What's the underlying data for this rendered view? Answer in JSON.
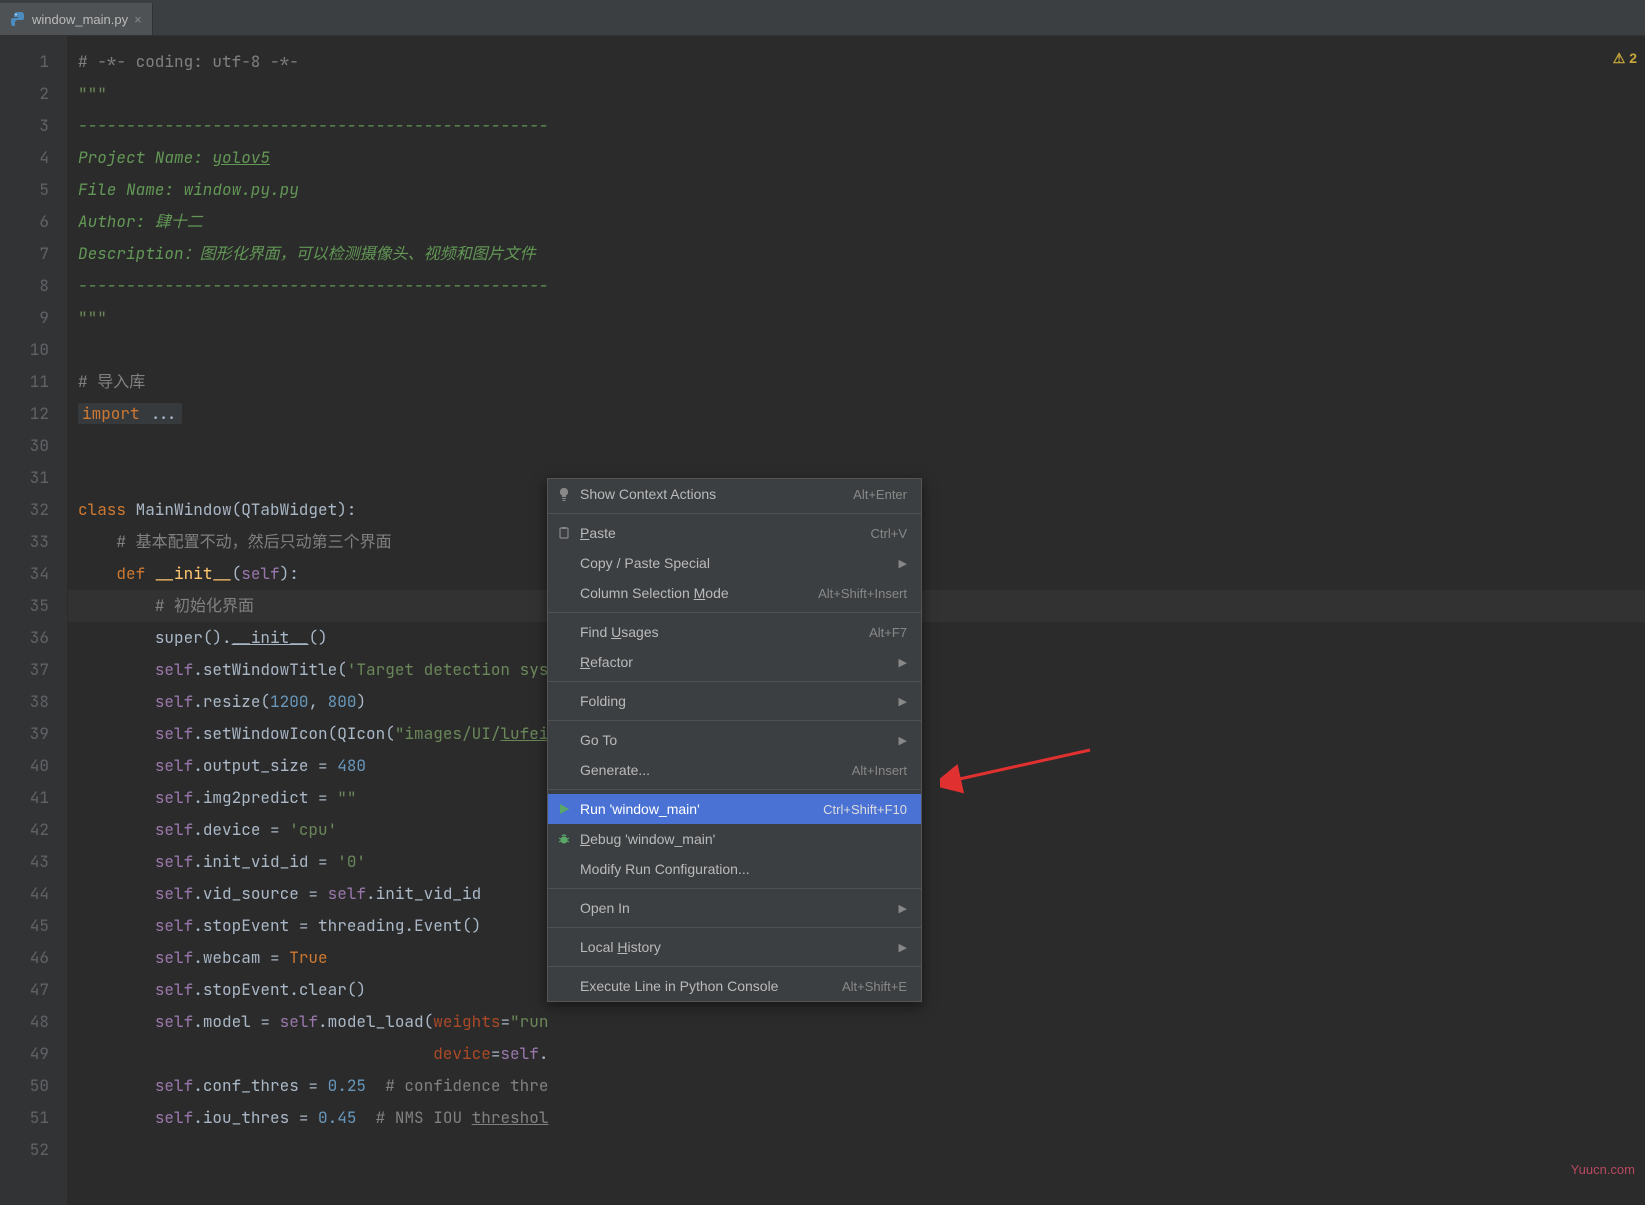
{
  "tab": {
    "filename": "window_main.py"
  },
  "warning_count": "2",
  "watermark": "Yuucn.com",
  "lines": [
    {
      "n": "1",
      "html": "<span class='c-gray'># -*- coding: utf-8 -*-</span>"
    },
    {
      "n": "2",
      "html": "<span class='c-green-str'>\"\"\"</span>"
    },
    {
      "n": "3",
      "html": "<span class='c-green'>-------------------------------------------------</span>"
    },
    {
      "n": "4",
      "html": "<span class='c-green'>Project Name: </span><span class='c-link'>yolov5</span>"
    },
    {
      "n": "5",
      "html": "<span class='c-green'>File Name: window.py.py</span>"
    },
    {
      "n": "6",
      "html": "<span class='c-green'>Author: 肆十二</span>"
    },
    {
      "n": "7",
      "html": "<span class='c-green'>Description：图形化界面，可以检测摄像头、视频和图片文件</span>"
    },
    {
      "n": "8",
      "html": "<span class='c-green'>-------------------------------------------------</span>"
    },
    {
      "n": "9",
      "html": "<span class='c-green-str'>\"\"\"</span>"
    },
    {
      "n": "10",
      "html": ""
    },
    {
      "n": "11",
      "html": "<span class='c-gray'># 导入库</span>"
    },
    {
      "n": "12",
      "html": "<span class='folded'><span class='c-orange'>import </span><span class='c-light'>...</span></span>"
    },
    {
      "n": "30",
      "html": ""
    },
    {
      "n": "31",
      "html": ""
    },
    {
      "n": "32",
      "html": "<span class='c-orange'>class </span><span class='c-light'>MainWindow(QTabWidget):</span>"
    },
    {
      "n": "33",
      "html": "    <span class='c-gray'># 基本配置不动，然后只动第三个界面</span>"
    },
    {
      "n": "34",
      "html": "    <span class='c-orange'>def </span><span class='c-yellow'>__init__</span><span class='c-light'>(</span><span class='c-purple'>self</span><span class='c-light'>):</span>"
    },
    {
      "n": "35",
      "html": "        <span class='c-gray'># 初始化界面</span>",
      "hl": true
    },
    {
      "n": "36",
      "html": "        <span class='c-light'>super().</span><span class='c-light c-under'>__init__</span><span class='c-light'>()</span>"
    },
    {
      "n": "37",
      "html": "        <span class='c-purple'>self</span><span class='c-light'>.setWindowTitle(</span><span class='c-green-str'>'Target detection sys</span>"
    },
    {
      "n": "38",
      "html": "        <span class='c-purple'>self</span><span class='c-light'>.resize(</span><span class='c-blue'>1200</span><span class='c-light'>, </span><span class='c-blue'>800</span><span class='c-light'>)</span>"
    },
    {
      "n": "39",
      "html": "        <span class='c-purple'>self</span><span class='c-light'>.setWindowIcon(QIcon(</span><span class='c-green-str'>\"images/UI/</span><span class='c-green-str c-under'>lufei</span>"
    },
    {
      "n": "40",
      "html": "        <span class='c-purple'>self</span><span class='c-light'>.output_size = </span><span class='c-blue'>480</span>"
    },
    {
      "n": "41",
      "html": "        <span class='c-purple'>self</span><span class='c-light'>.img2predict = </span><span class='c-green-str'>\"\"</span>"
    },
    {
      "n": "42",
      "html": "        <span class='c-purple'>self</span><span class='c-light'>.device = </span><span class='c-green-str'>'cpu'</span>"
    },
    {
      "n": "43",
      "html": "        <span class='c-purple'>self</span><span class='c-light'>.init_vid_id = </span><span class='c-green-str'>'0'</span>"
    },
    {
      "n": "44",
      "html": "        <span class='c-purple'>self</span><span class='c-light'>.vid_source = </span><span class='c-purple'>self</span><span class='c-light'>.init_vid_id</span>"
    },
    {
      "n": "45",
      "html": "        <span class='c-purple'>self</span><span class='c-light'>.stopEvent = threading.Event()</span>"
    },
    {
      "n": "46",
      "html": "        <span class='c-purple'>self</span><span class='c-light'>.webcam = </span><span class='c-orange'>True</span>"
    },
    {
      "n": "47",
      "html": "        <span class='c-purple'>self</span><span class='c-light'>.stopEvent.clear()</span>"
    },
    {
      "n": "48",
      "html": "        <span class='c-purple'>self</span><span class='c-light'>.model = </span><span class='c-purple'>self</span><span class='c-light'>.model_load(</span><span class='c-red-arg'>weights</span><span class='c-light'>=</span><span class='c-green-str'>\"run</span>"
    },
    {
      "n": "49",
      "html": "                                     <span class='c-red-arg'>device</span><span class='c-light'>=</span><span class='c-purple'>self</span><span class='c-light'>.</span>"
    },
    {
      "n": "50",
      "html": "        <span class='c-purple'>self</span><span class='c-light'>.conf_thres = </span><span class='c-blue'>0.25</span><span class='c-light'>  </span><span class='c-gray'># confidence thre</span>"
    },
    {
      "n": "51",
      "html": "        <span class='c-purple'>self</span><span class='c-light'>.iou_thres = </span><span class='c-blue'>0.45</span><span class='c-light'>  </span><span class='c-gray'># NMS IOU </span><span class='c-gray c-under'>threshol</span>"
    },
    {
      "n": "52",
      "html": ""
    }
  ],
  "menu": [
    {
      "type": "item",
      "icon": "bulb",
      "label": "Show Context Actions",
      "shortcut": "Alt+Enter"
    },
    {
      "type": "sep"
    },
    {
      "type": "item",
      "icon": "paste",
      "label": "<span class='mu'>P</span>aste",
      "shortcut": "Ctrl+V"
    },
    {
      "type": "item",
      "label": "Copy / Paste Special",
      "arrow": true
    },
    {
      "type": "item",
      "label": "Column Selection <span class='mu'>M</span>ode",
      "shortcut": "Alt+Shift+Insert"
    },
    {
      "type": "sep"
    },
    {
      "type": "item",
      "label": "Find <span class='mu'>U</span>sages",
      "shortcut": "Alt+F7"
    },
    {
      "type": "item",
      "label": "<span class='mu'>R</span>efactor",
      "arrow": true
    },
    {
      "type": "sep"
    },
    {
      "type": "item",
      "label": "Folding",
      "arrow": true
    },
    {
      "type": "sep"
    },
    {
      "type": "item",
      "label": "Go To",
      "arrow": true
    },
    {
      "type": "item",
      "label": "Generate...",
      "shortcut": "Alt+Insert"
    },
    {
      "type": "sep"
    },
    {
      "type": "item",
      "icon": "run",
      "label": "Run 'window_main'",
      "shortcut": "Ctrl+Shift+F10",
      "hl": true
    },
    {
      "type": "item",
      "icon": "bug",
      "label": "<span class='mu'>D</span>ebug 'window_main'"
    },
    {
      "type": "item",
      "label": "Modify Run Configuration..."
    },
    {
      "type": "sep"
    },
    {
      "type": "item",
      "label": "Open In",
      "arrow": true
    },
    {
      "type": "sep"
    },
    {
      "type": "item",
      "label": "Local <span class='mu'>H</span>istory",
      "arrow": true
    },
    {
      "type": "sep"
    },
    {
      "type": "item",
      "label": "Execute Line in Python Console",
      "shortcut": "Alt+Shift+E"
    }
  ]
}
